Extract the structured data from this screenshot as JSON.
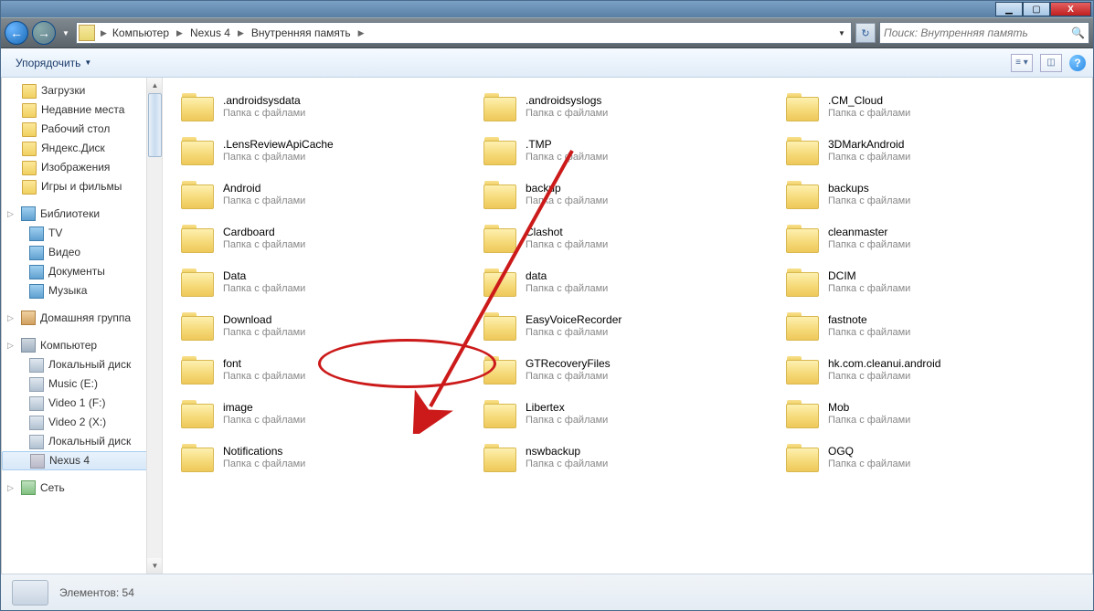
{
  "title_buttons": {
    "min": "▁",
    "max": "▢",
    "close": "X"
  },
  "breadcrumb": [
    {
      "label": "Компьютер"
    },
    {
      "label": "Nexus 4"
    },
    {
      "label": "Внутренняя память"
    }
  ],
  "search": {
    "placeholder": "Поиск: Внутренняя память"
  },
  "toolbar": {
    "organize": "Упорядочить"
  },
  "sidebar": {
    "favorites": [
      {
        "label": "Загрузки",
        "icon": "folder"
      },
      {
        "label": "Недавние места",
        "icon": "folder"
      },
      {
        "label": "Рабочий стол",
        "icon": "folder"
      },
      {
        "label": "Яндекс.Диск",
        "icon": "folder"
      },
      {
        "label": "Изображения",
        "icon": "folder"
      },
      {
        "label": "Игры и фильмы",
        "icon": "folder"
      }
    ],
    "libraries_label": "Библиотеки",
    "libraries": [
      {
        "label": "TV",
        "icon": "lib"
      },
      {
        "label": "Видео",
        "icon": "lib"
      },
      {
        "label": "Документы",
        "icon": "lib"
      },
      {
        "label": "Музыка",
        "icon": "lib"
      }
    ],
    "homegroup_label": "Домашняя группа",
    "computer_label": "Компьютер",
    "drives": [
      {
        "label": "Локальный диск",
        "icon": "drive"
      },
      {
        "label": "Music (E:)",
        "icon": "drive"
      },
      {
        "label": "Video 1 (F:)",
        "icon": "drive"
      },
      {
        "label": "Video 2 (X:)",
        "icon": "drive"
      },
      {
        "label": "Локальный диск",
        "icon": "drive"
      },
      {
        "label": "Nexus 4",
        "icon": "phone",
        "selected": true
      }
    ],
    "network_label": "Сеть"
  },
  "folder_subtitle": "Папка с файлами",
  "folders": [
    {
      "n": ".androidsysdata"
    },
    {
      "n": ".androidsyslogs"
    },
    {
      "n": ".CM_Cloud"
    },
    {
      "n": ".LensReviewApiCache"
    },
    {
      "n": ".TMP"
    },
    {
      "n": "3DMarkAndroid"
    },
    {
      "n": "Android"
    },
    {
      "n": "backup"
    },
    {
      "n": "backups"
    },
    {
      "n": "Cardboard"
    },
    {
      "n": "Clashot"
    },
    {
      "n": "cleanmaster"
    },
    {
      "n": "Data"
    },
    {
      "n": "data"
    },
    {
      "n": "DCIM"
    },
    {
      "n": "Download"
    },
    {
      "n": "EasyVoiceRecorder"
    },
    {
      "n": "fastnote"
    },
    {
      "n": "font"
    },
    {
      "n": "GTRecoveryFiles"
    },
    {
      "n": "hk.com.cleanui.android"
    },
    {
      "n": "image"
    },
    {
      "n": "Libertex"
    },
    {
      "n": "Mob"
    },
    {
      "n": "Notifications"
    },
    {
      "n": "nswbackup"
    },
    {
      "n": "OGQ"
    }
  ],
  "status": {
    "count_label": "Элементов:",
    "count": "54"
  }
}
